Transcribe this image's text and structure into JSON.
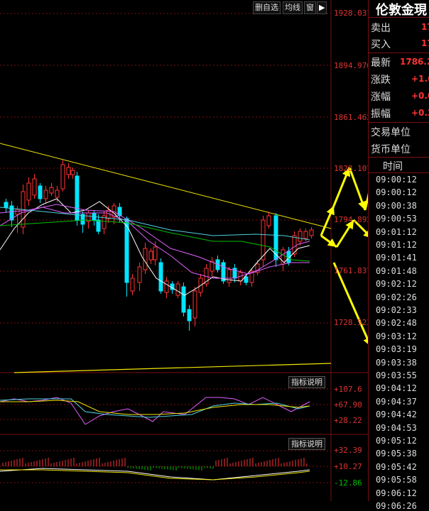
{
  "toolbar": {
    "add_watch": "删自选",
    "ma_line": "均线",
    "window": "窗",
    "arrow": "▶"
  },
  "price_axis": [
    "1928.031",
    "1894.976",
    "1861.462",
    "1828.107",
    "1794.892",
    "1761.837",
    "1728.523"
  ],
  "indicator1": {
    "button": "指标说明",
    "labels": [
      "+107.6",
      "+67.90",
      "+28.22"
    ]
  },
  "indicator2": {
    "button": "指标说明",
    "labels": [
      "+32.39",
      "+10.27",
      "-12.86"
    ]
  },
  "quote_panel": {
    "title": "伦敦金現",
    "sell_label": "卖出",
    "sell_value": "17",
    "buy_label": "买入",
    "buy_value": "17",
    "last_label": "最新",
    "last_value": "1786.2",
    "change_label": "涨跌",
    "change_value": "+1.6",
    "pct_label": "涨幅",
    "pct_value": "+0.0",
    "amp_label": "振幅",
    "amp_value": "+0.2",
    "unit_label": "交易单位",
    "currency_label": "货币单位",
    "time_header": "时间",
    "times": [
      "09:00:12",
      "09:00:12",
      "09:00:38",
      "09:00:53",
      "09:01:12",
      "09:01:12",
      "09:01:41",
      "09:01:48",
      "09:02:12",
      "09:02:26",
      "09:02:33",
      "09:02:48",
      "09:03:12",
      "09:03:19",
      "09:03:38",
      "09:03:55",
      "09:04:12",
      "09:04:37",
      "09:04:42",
      "09:04:53",
      "09:05:12",
      "09:05:38",
      "09:05:42",
      "09:05:58",
      "09:06:12",
      "09:06:26"
    ]
  },
  "colors": {
    "up": "#ff3333",
    "down": "#00e5ff",
    "ma_white": "#ffffff",
    "ma_yellow": "#f2e600",
    "ma_purple": "#e060ff",
    "ma_green": "#00c000",
    "ma_cyan": "#4fd0e0",
    "grid": "#7a1010",
    "annotation": "#ffff00"
  }
}
